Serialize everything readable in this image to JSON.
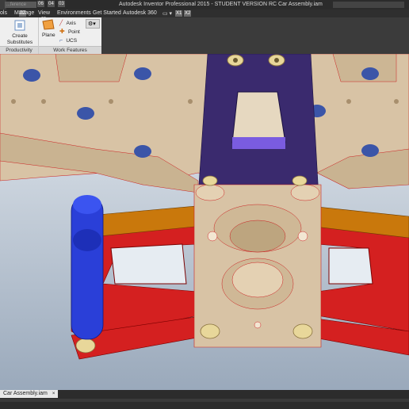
{
  "titlebar": {
    "search_placeholder": "...ference",
    "qa_badges": [
      "06",
      "04",
      "03"
    ],
    "app_title": "Autodesk Inventor Professional 2015 - STUDENT VERSION   RC Car Assembly.iam"
  },
  "ribbon_tabs": [
    {
      "label": "ols",
      "key": "ZZ"
    },
    {
      "label": "Manage",
      "key": "M"
    },
    {
      "label": "View",
      "key": "V"
    },
    {
      "label": "Environments",
      "key": "N"
    },
    {
      "label": "Get Started",
      "key": "GS"
    },
    {
      "label": "Autodesk 360",
      "key": "C"
    }
  ],
  "tab_extra_keys": [
    "X1",
    "X2"
  ],
  "ribbon": {
    "productivity": {
      "title": "Productivity",
      "create_substitutes": "Create\nSubstitutes"
    },
    "work_features": {
      "title": "Work Features",
      "plane": "Plane",
      "axis": "Axis",
      "point": "Point",
      "ucs": "UCS"
    }
  },
  "document_tab": {
    "label": "Car Assembly.iam",
    "close": "×"
  },
  "colors": {
    "plate": "#d8c3a5",
    "link_purple": "#3a2a6e",
    "arm_red": "#d42020",
    "arm_orange": "#c9780c",
    "blue_part": "#2a3fd8"
  }
}
